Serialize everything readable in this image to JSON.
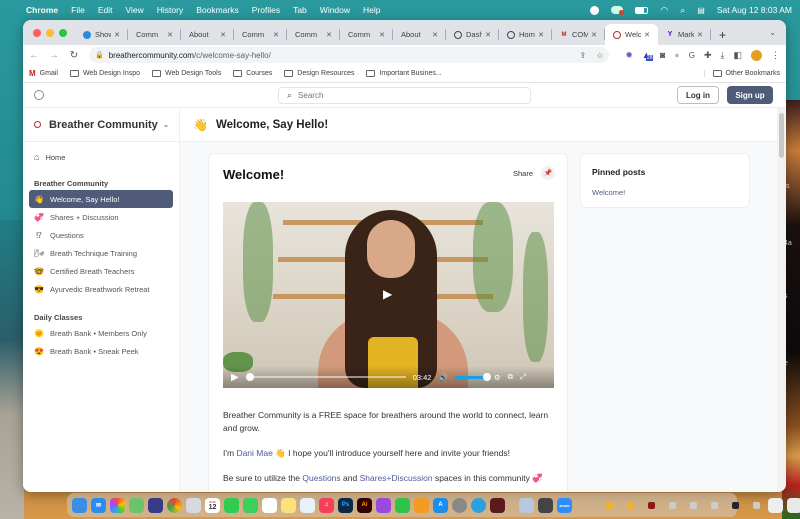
{
  "menubar": {
    "app": "Chrome",
    "items": [
      "File",
      "Edit",
      "View",
      "History",
      "Bookmarks",
      "Profiles",
      "Tab",
      "Window",
      "Help"
    ],
    "clock": "Sat Aug 12  8:03 AM"
  },
  "browser": {
    "tabs": [
      {
        "label": "Showit",
        "icon": "showit-icon",
        "active": false
      },
      {
        "label": "Comm",
        "icon": "",
        "active": false
      },
      {
        "label": "About",
        "icon": "",
        "active": false
      },
      {
        "label": "Comm",
        "icon": "",
        "active": false
      },
      {
        "label": "Comm",
        "icon": "",
        "active": false
      },
      {
        "label": "Comm",
        "icon": "",
        "active": false
      },
      {
        "label": "About",
        "icon": "",
        "active": false
      },
      {
        "label": "Dashb",
        "icon": "globe-icon",
        "active": false
      },
      {
        "label": "Home",
        "icon": "globe-icon",
        "active": false
      },
      {
        "label": "COMM",
        "icon": "gmail-icon",
        "active": false
      },
      {
        "label": "Welco",
        "icon": "community-icon",
        "active": true
      },
      {
        "label": "MarkU",
        "icon": "yahoo-icon",
        "active": false
      }
    ],
    "url_host": "breathercommunity.com",
    "url_path": "/c/welcome-say-hello/",
    "bookmarks": [
      "Gmail",
      "Web Design Inspo",
      "Web Design Tools",
      "Courses",
      "Design Resources",
      "Important Busines..."
    ],
    "other_bookmarks": "Other Bookmarks",
    "extension_badge": "28"
  },
  "site": {
    "search_placeholder": "Search",
    "login_label": "Log in",
    "signup_label": "Sign up",
    "accent_color": "#4f5b79",
    "community_name": "Breather Community",
    "home_label": "Home",
    "sections": [
      {
        "title": "Breather Community",
        "items": [
          {
            "emoji": "👋",
            "label": "Welcome, Say Hello!",
            "active": true
          },
          {
            "emoji": "💞",
            "label": "Shares + Discussion",
            "active": false
          },
          {
            "emoji": "⁉",
            "label": "Questions",
            "active": false
          },
          {
            "emoji": "🌬",
            "label": "Breath Technique Training",
            "active": false
          },
          {
            "emoji": "🤓",
            "label": "Certified Breath Teachers",
            "active": false
          },
          {
            "emoji": "😎",
            "label": "Ayurvedic Breathwork Retreat",
            "active": false
          }
        ]
      },
      {
        "title": "Daily Classes",
        "items": [
          {
            "emoji": "🌞",
            "label": "Breath Bank • Members Only",
            "active": false
          },
          {
            "emoji": "😍",
            "label": "Breath Bank • Sneak Peek",
            "active": false
          }
        ]
      }
    ],
    "space_emoji": "👋",
    "space_title": "Welcome, Say Hello!",
    "post": {
      "title": "Welcome!",
      "share_label": "Share",
      "video": {
        "duration": "03:42",
        "progress": 0.0,
        "volume": 1.0
      },
      "paragraph1": "Breather Community is a FREE space for breathers around the world to connect, learn and grow.",
      "p2_pre": "I'm ",
      "p2_link": "Dani Mae",
      "p2_post": " 👋 I hope you'll introduce yourself here and invite your friends!",
      "p3_pre": "Be sure to utilize the ",
      "p3_link1": "Questions",
      "p3_mid": " and ",
      "p3_link2": "Shares+Discussion",
      "p3_post": " spaces in this community 💞"
    },
    "pinned": {
      "title": "Pinned posts",
      "items": [
        "Welcome!"
      ]
    }
  },
  "dock": {
    "calendar_month": "AUG",
    "calendar_day": "12",
    "apps": [
      "Finder",
      "Mail",
      "Photos",
      "Maps",
      "Shortcuts",
      "Chrome",
      "Launchpad",
      "Calendar",
      "FaceTime",
      "Messages",
      "Reminders",
      "Notes",
      "Freeform",
      "Music",
      "Photoshop",
      "Illustrator",
      "Podcasts",
      "Numbers",
      "Pages",
      "App Store",
      "System Settings",
      "Telegram",
      "Photo Booth",
      "Preview",
      "Calculator",
      "Zoom",
      "Trash"
    ]
  }
}
